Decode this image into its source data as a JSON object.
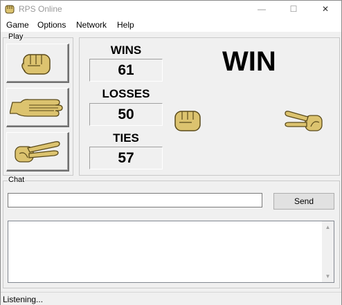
{
  "window": {
    "title": "RPS Online",
    "minimize": "—",
    "maximize": "☐",
    "close": "✕"
  },
  "menu": [
    "Game",
    "Options",
    "Network",
    "Help"
  ],
  "play": {
    "label": "Play",
    "buttons": [
      {
        "name": "rock",
        "icon": "fist-icon"
      },
      {
        "name": "paper",
        "icon": "flat-hand-icon"
      },
      {
        "name": "scissors",
        "icon": "scissors-hand-icon"
      }
    ]
  },
  "stats": {
    "wins_label": "WINS",
    "wins": "61",
    "losses_label": "LOSSES",
    "losses": "50",
    "ties_label": "TIES",
    "ties": "57"
  },
  "result": {
    "text": "WIN",
    "player_choice": "rock",
    "opponent_choice": "scissors"
  },
  "chat": {
    "label": "Chat",
    "input_value": "",
    "send_label": "Send"
  },
  "status": {
    "text": "Listening..."
  },
  "colors": {
    "hand_fill": "#dcc36f",
    "hand_stroke": "#5a4a1a",
    "background": "#f0f0f0"
  }
}
